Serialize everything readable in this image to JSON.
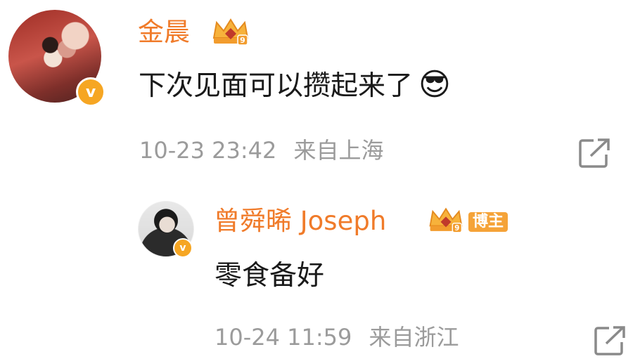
{
  "comment": {
    "username": "金晨",
    "content": "下次见面可以攒起来了",
    "emoji": "😎",
    "time": "10-23 23:42",
    "location": "来自上海"
  },
  "reply": {
    "username": "曾舜晞 Joseph",
    "badge_label": "博主",
    "content": "零食备好",
    "time": "10-24 11:59",
    "location": "来自浙江"
  },
  "badges": {
    "verified_letter": "v",
    "crown_level": "9"
  },
  "colors": {
    "username": "#f07b2a",
    "meta": "#9b9b9b",
    "verified": "#f6a623"
  }
}
